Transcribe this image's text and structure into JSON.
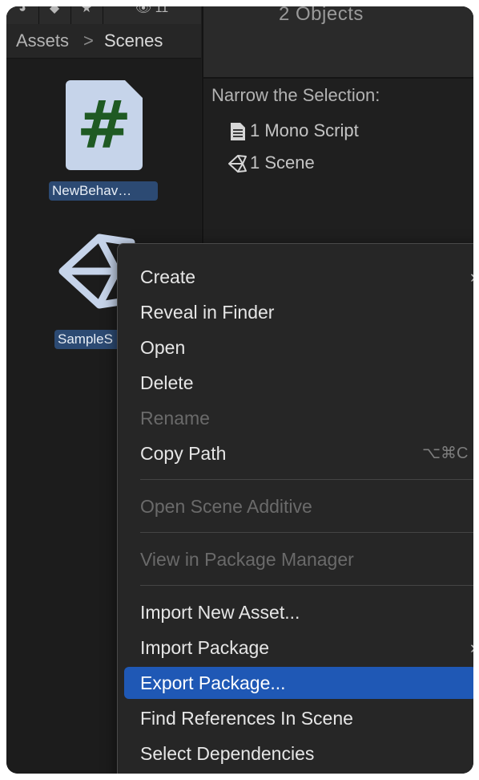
{
  "toolbar": {
    "buttons": [
      {
        "icon": "layers-icon",
        "glyph": "◕"
      },
      {
        "icon": "tag-icon",
        "glyph": "◆"
      },
      {
        "icon": "star-icon",
        "glyph": "★"
      },
      {
        "icon": "eye-hidden-icon",
        "glyph": "👁 11"
      }
    ]
  },
  "breadcrumb": {
    "root": "Assets",
    "separator": ">",
    "current": "Scenes"
  },
  "assets": [
    {
      "label": "NewBehav…",
      "icon": "csharp-script-icon",
      "glyph": "#"
    },
    {
      "label": "SampleS",
      "icon": "unity-scene-icon"
    }
  ],
  "inspector": {
    "count_text": "2 Objects",
    "narrow_title": "Narrow the Selection:",
    "items": [
      {
        "label": "1 Mono Script",
        "icon": "document-icon"
      },
      {
        "label": "1 Scene",
        "icon": "unity-icon"
      }
    ]
  },
  "context_menu": {
    "create": "Create",
    "reveal": "Reveal in Finder",
    "open": "Open",
    "delete": "Delete",
    "rename": "Rename",
    "copy_path": "Copy Path",
    "copy_path_shortcut": "⌥⌘C",
    "open_scene_additive": "Open Scene Additive",
    "view_package_manager": "View in Package Manager",
    "import_new_asset": "Import New Asset...",
    "import_package": "Import Package",
    "export_package": "Export Package...",
    "find_references": "Find References In Scene",
    "select_dependencies": "Select Dependencies",
    "submenu_arrow": "›"
  },
  "colors": {
    "highlight": "#1f58b5",
    "selection_label": "#2c4a73",
    "script_icon_bg": "#c6d4ea",
    "script_hash": "#1f5a23"
  }
}
